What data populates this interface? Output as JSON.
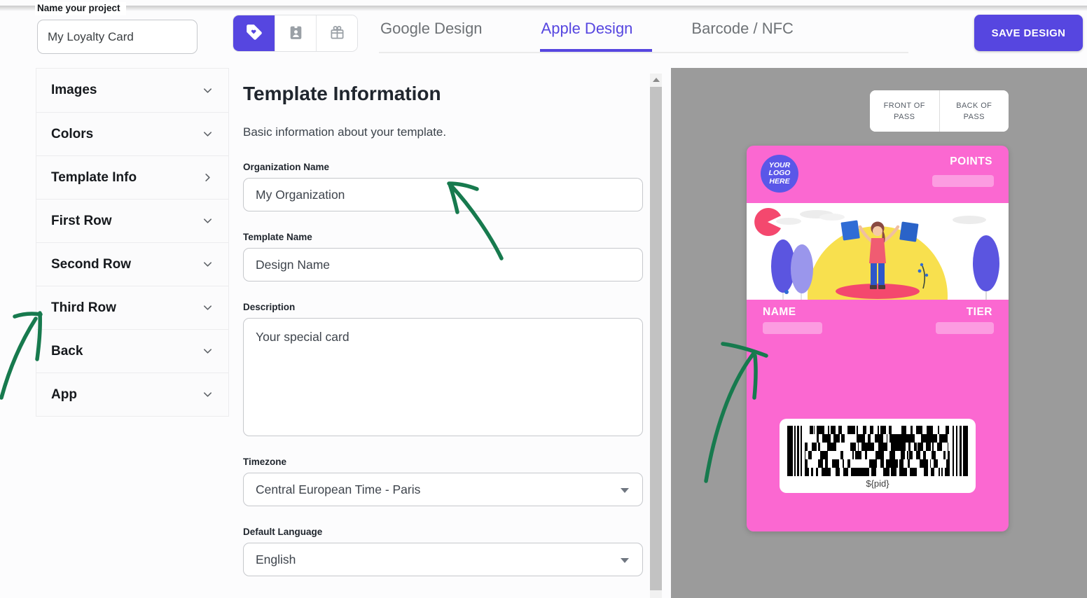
{
  "header": {
    "project_label": "Name your project",
    "project_name": "My Loyalty Card",
    "toolbar_icons": [
      {
        "name": "tag-icon",
        "active": true
      },
      {
        "name": "id-badge-icon",
        "active": false
      },
      {
        "name": "gift-icon",
        "active": false
      }
    ],
    "tabs": [
      {
        "label": "Google Design",
        "active": false
      },
      {
        "label": "Apple Design",
        "active": true
      },
      {
        "label": "Barcode / NFC",
        "active": false
      }
    ],
    "save_button": "SAVE DESIGN"
  },
  "sidebar": {
    "items": [
      {
        "label": "Images",
        "chevron": "down"
      },
      {
        "label": "Colors",
        "chevron": "down"
      },
      {
        "label": "Template Info",
        "chevron": "right"
      },
      {
        "label": "First Row",
        "chevron": "down"
      },
      {
        "label": "Second Row",
        "chevron": "down"
      },
      {
        "label": "Third Row",
        "chevron": "down"
      },
      {
        "label": "Back",
        "chevron": "down"
      },
      {
        "label": "App",
        "chevron": "down"
      }
    ]
  },
  "form": {
    "title": "Template Information",
    "subtitle": "Basic information about your template.",
    "fields": {
      "organization_name": {
        "label": "Organization Name",
        "value": "My Organization"
      },
      "template_name": {
        "label": "Template Name",
        "value": "Design Name"
      },
      "description": {
        "label": "Description",
        "value": "Your special card"
      },
      "timezone": {
        "label": "Timezone",
        "value": "Central European Time - Paris"
      },
      "default_language": {
        "label": "Default Language",
        "value": "English"
      }
    }
  },
  "preview": {
    "front_button": "FRONT OF PASS",
    "back_button": "BACK OF PASS",
    "card": {
      "logo_text": "YOUR LOGO HERE",
      "points_label": "POINTS",
      "name_label": "NAME",
      "tier_label": "TIER",
      "barcode_value": "${pid}"
    }
  },
  "colors": {
    "accent": "#5646e0",
    "card_pink": "#fb68d1",
    "preview_gray": "#9b9b9b",
    "arrow_green": "#177a4e"
  }
}
